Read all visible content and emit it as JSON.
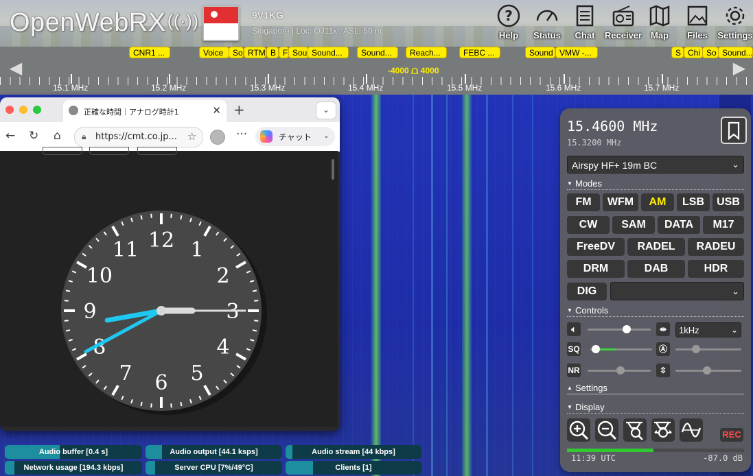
{
  "header": {
    "logo_text": "OpenWebRX",
    "receiver_callsign": "9V1KG",
    "receiver_location": "Singapore | Loc: OJ11xl, ASL: 50 m",
    "buttons": [
      {
        "label": "Help",
        "icon": "help-icon"
      },
      {
        "label": "Status",
        "icon": "gauge-icon"
      },
      {
        "label": "Chat",
        "icon": "chat-icon"
      },
      {
        "label": "Receiver",
        "icon": "radio-icon"
      },
      {
        "label": "Map",
        "icon": "map-icon"
      },
      {
        "label": "Files",
        "icon": "image-icon"
      },
      {
        "label": "Settings",
        "icon": "gear-icon"
      }
    ]
  },
  "scale": {
    "bookmarks": [
      "CNR1 ...",
      "Voice",
      "So",
      "RTM",
      "B",
      "F",
      "Sou",
      "Sound...",
      "Sound...",
      "Reach...",
      "FEBC ...",
      "Sound",
      "VMW -...",
      "S",
      "Chi",
      "So",
      "Sound..."
    ],
    "bandwidth_low": "-4000",
    "bandwidth_high": "4000",
    "freq_labels": [
      "15.1 MHz",
      "15.2 MHz",
      "15.3 MHz",
      "15.4 MHz",
      "15.5 MHz",
      "15.6 MHz",
      "15.7 MHz"
    ]
  },
  "browser": {
    "tab_title": "正確な時間｜アナログ時計1",
    "url": "https://cmt.co.jp...",
    "copilot_label": "チャット"
  },
  "analog_clock": {
    "numerals": [
      "12",
      "1",
      "2",
      "3",
      "4",
      "5",
      "6",
      "7",
      "8",
      "9",
      "10",
      "11"
    ],
    "shown_time": {
      "hour": 8,
      "minute": 40,
      "second": 15
    }
  },
  "panel": {
    "frequency": "15.4600 MHz",
    "offset_frequency": "15.3200 MHz",
    "profile": "Airspy HF+ 19m BC",
    "sections": {
      "modes": "Modes",
      "controls": "Controls",
      "settings": "Settings",
      "display": "Display"
    },
    "modes_row1": [
      "FM",
      "WFM",
      "AM",
      "LSB",
      "USB"
    ],
    "modes_row2": [
      "CW",
      "SAM",
      "DATA",
      "M17"
    ],
    "modes_row3": [
      "FreeDV",
      "RADEL",
      "RADEU"
    ],
    "modes_row4": [
      "DRM",
      "DAB",
      "HDR"
    ],
    "digital_label": "DIG",
    "active_mode": "AM",
    "step": "1kHz",
    "squelch_label": "SQ",
    "nr_label": "NR",
    "volume_level": 0.62,
    "squelch_level": 0.0,
    "rec_label": "REC",
    "utc_time": "11:39 UTC",
    "signal_level": "-87.0 dB",
    "smeter_fill": 0.49
  },
  "status": {
    "audio_buffer": "Audio buffer [0.4 s]",
    "audio_output": "Audio output [44.1 ksps]",
    "audio_stream": "Audio stream [44 kbps]",
    "network_usage": "Network usage [194.3 kbps]",
    "server_cpu": "Server CPU [7%/49°C]",
    "clients": "Clients [1]"
  },
  "colors": {
    "bookmark": "#ffee00",
    "waterfall": "#2233b8",
    "active_mode": "#ffee00",
    "status_bar": "#0e3b48"
  }
}
